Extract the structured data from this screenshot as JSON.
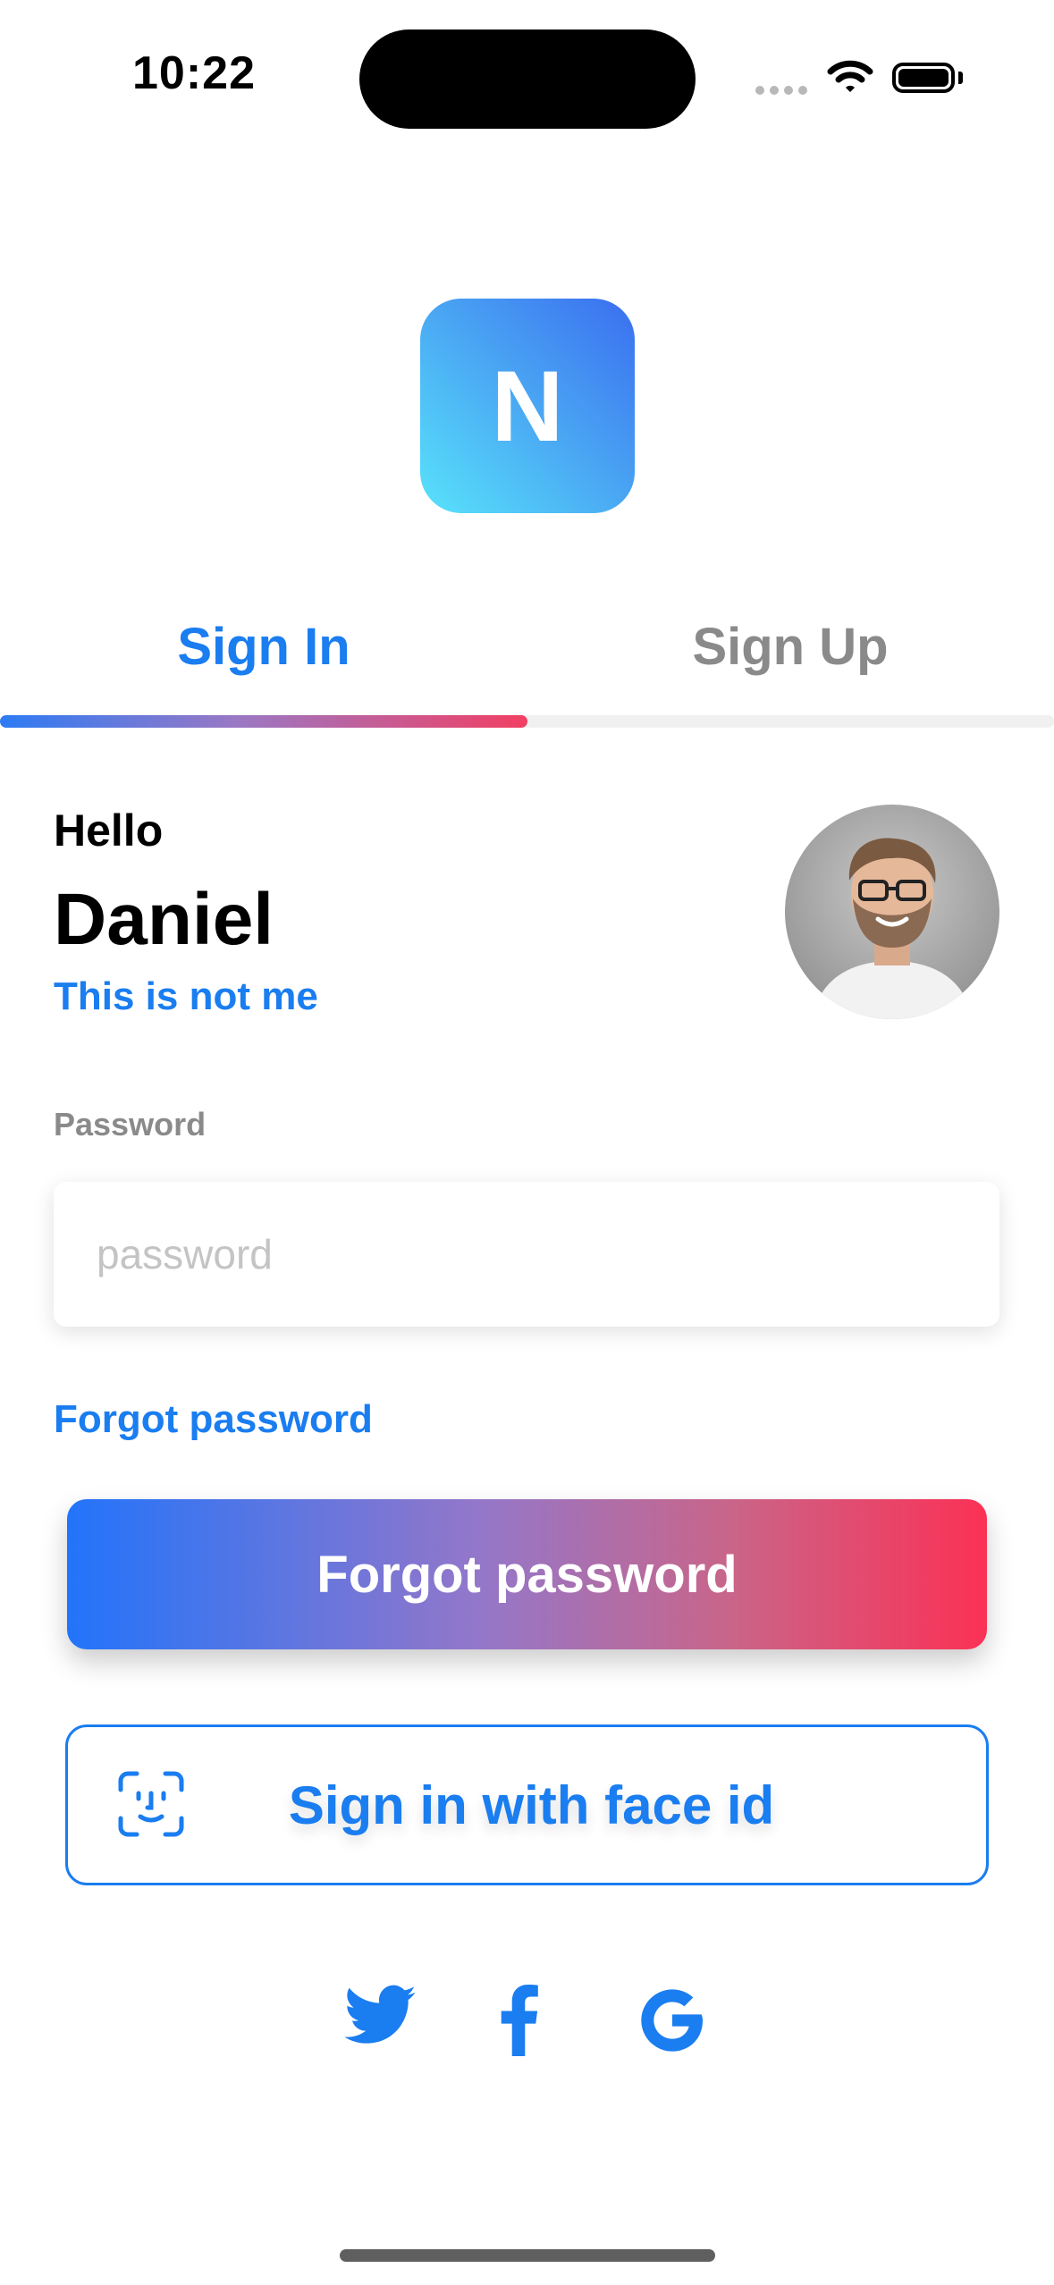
{
  "status_bar": {
    "time": "10:22"
  },
  "logo": {
    "letter": "N"
  },
  "tabs": [
    {
      "label": "Sign In",
      "active": true
    },
    {
      "label": "Sign Up",
      "active": false
    }
  ],
  "greeting": {
    "hello": "Hello",
    "name": "Daniel",
    "not_me": "This is not me"
  },
  "password": {
    "label": "Password",
    "placeholder": "password",
    "value": ""
  },
  "forgot_link": "Forgot password",
  "primary_button": "Forgot password",
  "faceid_button": "Sign in with face id",
  "social": [
    "twitter-icon",
    "facebook-icon",
    "google-icon"
  ],
  "colors": {
    "accent": "#1a7df0",
    "gradient_start": "#2274fb",
    "gradient_end": "#fb3155",
    "muted": "#8a8a8a"
  }
}
